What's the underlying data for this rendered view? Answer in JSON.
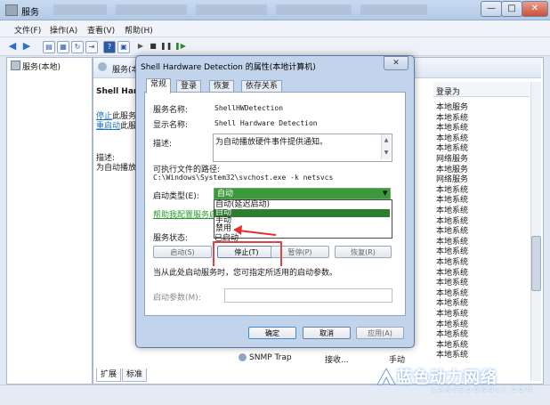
{
  "window": {
    "title": "服务",
    "min": "—",
    "max": "□",
    "close": "✕"
  },
  "menu": [
    "文件(F)",
    "操作(A)",
    "查看(V)",
    "帮助(H)"
  ],
  "tree": {
    "root": "服务(本地)"
  },
  "main": {
    "header": "服务(本",
    "service_name_partial": "Shell Hardw",
    "link_stop_word": "停止",
    "link_stop_suffix": "此服务",
    "link_restart_word": "重启动",
    "link_restart_suffix": "此服",
    "desc_label": "描述:",
    "desc_partial": "为自动播放",
    "col_login": "登录为",
    "login_rows": [
      "本地服务",
      "本地系统",
      "本地系统",
      "本地系统",
      "本地系统",
      "网络服务",
      "本地服务",
      "网络服务",
      "本地系统",
      "本地系统",
      "本地系统",
      "本地系统",
      "本地系统",
      "本地系统",
      "本地系统",
      "本地系统",
      "本地系统",
      "本地系统",
      "本地系统",
      "本地系统",
      "本地系统",
      "本地系统",
      "本地系统",
      "本地系统",
      "本地系统"
    ],
    "row_snmp": {
      "name": "SNMP Trap",
      "desc": "接收...",
      "startup": "手动"
    },
    "bottom_tabs": [
      "扩展",
      "标准"
    ]
  },
  "dialog": {
    "title": "Shell Hardware Detection 的属性(本地计算机)",
    "close": "✕",
    "tabs": [
      "常规",
      "登录",
      "恢复",
      "依存关系"
    ],
    "service_name_label": "服务名称:",
    "service_name": "ShellHWDetection",
    "display_name_label": "显示名称:",
    "display_name": "Shell Hardware Detection",
    "desc_label": "描述:",
    "desc": "为自动播放硬件事件提供通知。",
    "exe_label": "可执行文件的路径:",
    "exe_path": "C:\\Windows\\System32\\svchost.exe -k netsvcs",
    "startup_label": "启动类型(E):",
    "startup_selected": "自动",
    "startup_options": [
      "自动(延迟启动)",
      "自动",
      "手动",
      "禁用"
    ],
    "help_link": "帮助我配置服务启",
    "status_label": "服务状态:",
    "status_value": "已启动",
    "btn_start": "启动(S)",
    "btn_stop": "停止(T)",
    "btn_pause": "暂停(P)",
    "btn_resume": "恢复(R)",
    "hint": "当从此处启动服务时，您可指定所适用的启动参数。",
    "params_label": "启动参数(M):",
    "ok": "确定",
    "cancel": "取消",
    "apply": "应用(A)"
  },
  "watermark": {
    "cn": "蓝色动力网络",
    "en": "LANSEDONGLI.COM"
  }
}
